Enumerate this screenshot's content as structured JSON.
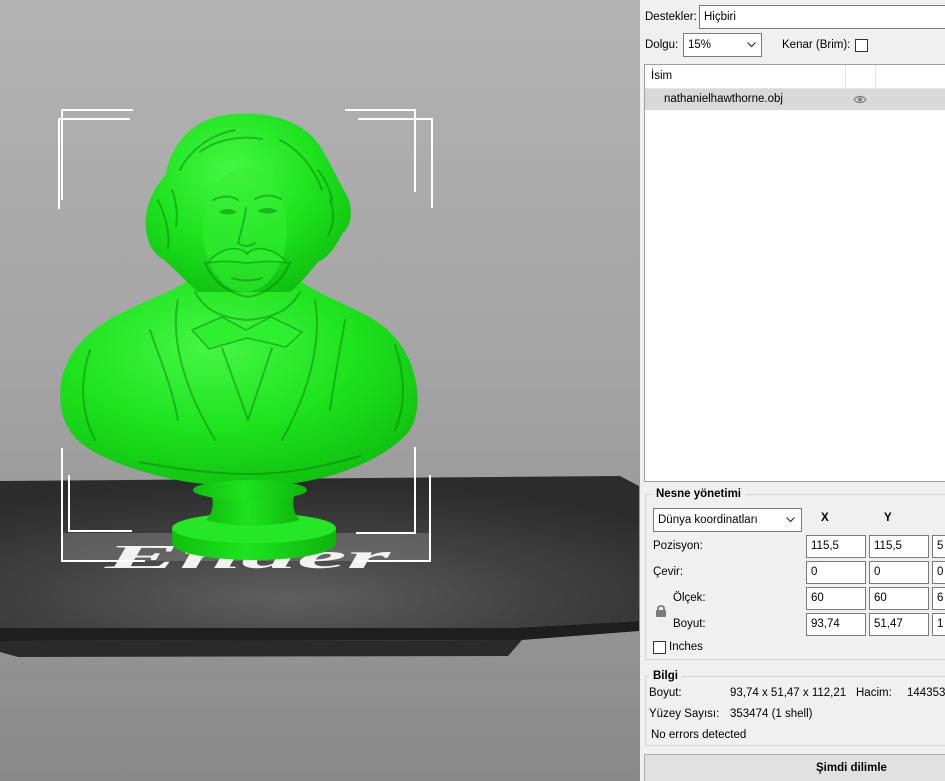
{
  "viewport": {
    "bed_logo": "Ender"
  },
  "print_settings": {
    "supports_label": "Destekler:",
    "supports_value": "Hiçbiri",
    "infill_label": "Dolgu:",
    "infill_value": "15%",
    "brim_label": "Kenar (Brim):",
    "brim_checked": false
  },
  "object_list": {
    "column_name": "İsim",
    "items": [
      {
        "name": "nathanielhawthorne.obj",
        "icon": "eye-icon",
        "selected": true
      }
    ]
  },
  "object_manipulation": {
    "title": "Nesne yönetimi",
    "coordinate_system": "Dünya koordinatları",
    "axis_x": "X",
    "axis_y": "Y",
    "rows": [
      {
        "label": "Pozisyon:",
        "values": [
          "115,5",
          "115,5",
          "5"
        ]
      },
      {
        "label": "Çevir:",
        "values": [
          "0",
          "0",
          "0"
        ]
      },
      {
        "label": "Ölçek:",
        "values": [
          "60",
          "60",
          "6"
        ]
      },
      {
        "label": "Boyut:",
        "values": [
          "93,74",
          "51,47",
          "1"
        ]
      }
    ],
    "scale_lock_icon": "lock-icon",
    "inches_label": "Inches",
    "inches_checked": false
  },
  "info": {
    "title": "Bilgi",
    "size_label": "Boyut:",
    "size_value": "93,74 x 51,47 x 112,21",
    "volume_label": "Hacim:",
    "volume_value": "144353",
    "facets_label": "Yüzey Sayısı:",
    "facets_value": "353474 (1 shell)",
    "status": "No errors detected"
  },
  "slice_button": {
    "label": "Şimdi dilimle"
  },
  "colors": {
    "model": "#1ee31e",
    "selected_row": "#d9d9d9",
    "bounding_box": "#ffffff"
  }
}
